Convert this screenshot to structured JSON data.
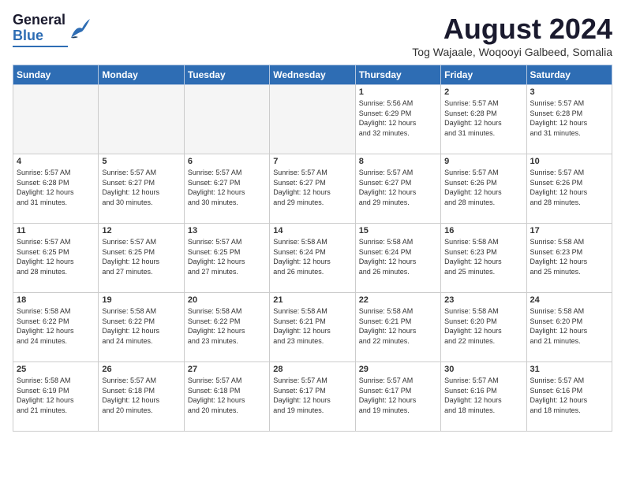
{
  "header": {
    "logo": "GeneralBlue",
    "month": "August 2024",
    "location": "Tog Wajaale, Woqooyi Galbeed, Somalia"
  },
  "weekdays": [
    "Sunday",
    "Monday",
    "Tuesday",
    "Wednesday",
    "Thursday",
    "Friday",
    "Saturday"
  ],
  "weeks": [
    [
      {
        "day": "",
        "info": ""
      },
      {
        "day": "",
        "info": ""
      },
      {
        "day": "",
        "info": ""
      },
      {
        "day": "",
        "info": ""
      },
      {
        "day": "1",
        "info": "Sunrise: 5:56 AM\nSunset: 6:29 PM\nDaylight: 12 hours\nand 32 minutes."
      },
      {
        "day": "2",
        "info": "Sunrise: 5:57 AM\nSunset: 6:28 PM\nDaylight: 12 hours\nand 31 minutes."
      },
      {
        "day": "3",
        "info": "Sunrise: 5:57 AM\nSunset: 6:28 PM\nDaylight: 12 hours\nand 31 minutes."
      }
    ],
    [
      {
        "day": "4",
        "info": "Sunrise: 5:57 AM\nSunset: 6:28 PM\nDaylight: 12 hours\nand 31 minutes."
      },
      {
        "day": "5",
        "info": "Sunrise: 5:57 AM\nSunset: 6:27 PM\nDaylight: 12 hours\nand 30 minutes."
      },
      {
        "day": "6",
        "info": "Sunrise: 5:57 AM\nSunset: 6:27 PM\nDaylight: 12 hours\nand 30 minutes."
      },
      {
        "day": "7",
        "info": "Sunrise: 5:57 AM\nSunset: 6:27 PM\nDaylight: 12 hours\nand 29 minutes."
      },
      {
        "day": "8",
        "info": "Sunrise: 5:57 AM\nSunset: 6:27 PM\nDaylight: 12 hours\nand 29 minutes."
      },
      {
        "day": "9",
        "info": "Sunrise: 5:57 AM\nSunset: 6:26 PM\nDaylight: 12 hours\nand 28 minutes."
      },
      {
        "day": "10",
        "info": "Sunrise: 5:57 AM\nSunset: 6:26 PM\nDaylight: 12 hours\nand 28 minutes."
      }
    ],
    [
      {
        "day": "11",
        "info": "Sunrise: 5:57 AM\nSunset: 6:25 PM\nDaylight: 12 hours\nand 28 minutes."
      },
      {
        "day": "12",
        "info": "Sunrise: 5:57 AM\nSunset: 6:25 PM\nDaylight: 12 hours\nand 27 minutes."
      },
      {
        "day": "13",
        "info": "Sunrise: 5:57 AM\nSunset: 6:25 PM\nDaylight: 12 hours\nand 27 minutes."
      },
      {
        "day": "14",
        "info": "Sunrise: 5:58 AM\nSunset: 6:24 PM\nDaylight: 12 hours\nand 26 minutes."
      },
      {
        "day": "15",
        "info": "Sunrise: 5:58 AM\nSunset: 6:24 PM\nDaylight: 12 hours\nand 26 minutes."
      },
      {
        "day": "16",
        "info": "Sunrise: 5:58 AM\nSunset: 6:23 PM\nDaylight: 12 hours\nand 25 minutes."
      },
      {
        "day": "17",
        "info": "Sunrise: 5:58 AM\nSunset: 6:23 PM\nDaylight: 12 hours\nand 25 minutes."
      }
    ],
    [
      {
        "day": "18",
        "info": "Sunrise: 5:58 AM\nSunset: 6:22 PM\nDaylight: 12 hours\nand 24 minutes."
      },
      {
        "day": "19",
        "info": "Sunrise: 5:58 AM\nSunset: 6:22 PM\nDaylight: 12 hours\nand 24 minutes."
      },
      {
        "day": "20",
        "info": "Sunrise: 5:58 AM\nSunset: 6:22 PM\nDaylight: 12 hours\nand 23 minutes."
      },
      {
        "day": "21",
        "info": "Sunrise: 5:58 AM\nSunset: 6:21 PM\nDaylight: 12 hours\nand 23 minutes."
      },
      {
        "day": "22",
        "info": "Sunrise: 5:58 AM\nSunset: 6:21 PM\nDaylight: 12 hours\nand 22 minutes."
      },
      {
        "day": "23",
        "info": "Sunrise: 5:58 AM\nSunset: 6:20 PM\nDaylight: 12 hours\nand 22 minutes."
      },
      {
        "day": "24",
        "info": "Sunrise: 5:58 AM\nSunset: 6:20 PM\nDaylight: 12 hours\nand 21 minutes."
      }
    ],
    [
      {
        "day": "25",
        "info": "Sunrise: 5:58 AM\nSunset: 6:19 PM\nDaylight: 12 hours\nand 21 minutes."
      },
      {
        "day": "26",
        "info": "Sunrise: 5:57 AM\nSunset: 6:18 PM\nDaylight: 12 hours\nand 20 minutes."
      },
      {
        "day": "27",
        "info": "Sunrise: 5:57 AM\nSunset: 6:18 PM\nDaylight: 12 hours\nand 20 minutes."
      },
      {
        "day": "28",
        "info": "Sunrise: 5:57 AM\nSunset: 6:17 PM\nDaylight: 12 hours\nand 19 minutes."
      },
      {
        "day": "29",
        "info": "Sunrise: 5:57 AM\nSunset: 6:17 PM\nDaylight: 12 hours\nand 19 minutes."
      },
      {
        "day": "30",
        "info": "Sunrise: 5:57 AM\nSunset: 6:16 PM\nDaylight: 12 hours\nand 18 minutes."
      },
      {
        "day": "31",
        "info": "Sunrise: 5:57 AM\nSunset: 6:16 PM\nDaylight: 12 hours\nand 18 minutes."
      }
    ]
  ]
}
